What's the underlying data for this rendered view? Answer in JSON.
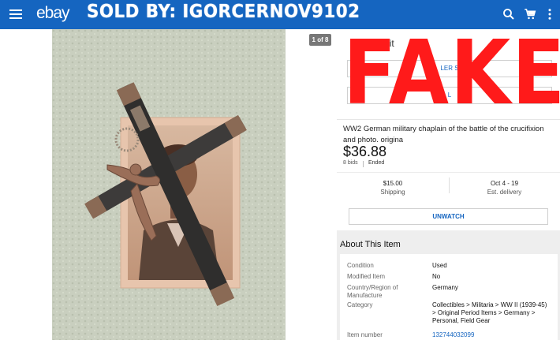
{
  "topbar": {
    "logo": "ebay",
    "overlay_text": "SOLD BY: IGORCERNOV9102"
  },
  "gallery": {
    "counter": "1 of 8"
  },
  "panel": {
    "partial_text": "u m        ut o     it",
    "button_1_partial": "LER         S",
    "button_2_partial": "L",
    "stamp": "FAKE"
  },
  "item": {
    "title": "WW2 German military chaplain of the battle of the crucifixion and photo. origina",
    "price": "$36.88",
    "bids": "8 bids",
    "status": "Ended",
    "shipping_price": "$15.00",
    "shipping_label": "Shipping",
    "delivery_date": "Oct 4 - 19",
    "delivery_label": "Est. delivery"
  },
  "actions": {
    "unwatch": "UNWATCH"
  },
  "about": {
    "heading": "About This Item",
    "specs": [
      {
        "label": "Condition",
        "value": "Used"
      },
      {
        "label": "Modified Item",
        "value": "No"
      },
      {
        "label": "Country/Region of Manufacture",
        "value": "Germany"
      },
      {
        "label": "Category",
        "value": "Collectibles > Militaria > WW II (1939-45) > Original Period Items > Germany > Personal, Field Gear"
      },
      {
        "label": "Item number",
        "value": "132744032099"
      }
    ]
  },
  "colors": {
    "appbar": "#1565c0",
    "link": "#1565c0",
    "stamp": "#ff1a1a"
  },
  "icons": [
    "menu-icon",
    "search-icon",
    "cart-icon",
    "more-vert-icon"
  ]
}
